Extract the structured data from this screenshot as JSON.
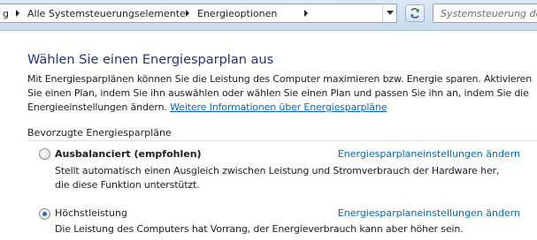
{
  "address_bar": {
    "fragment": "g",
    "crumbs": [
      "Alle Systemsteuerungselemente",
      "Energieoptionen"
    ],
    "dropdown_icon": "chevron-down-icon",
    "refresh_icon": "refresh-icon"
  },
  "search": {
    "placeholder": "Systemsteuerung durch"
  },
  "main": {
    "title": "Wählen Sie einen Energiesparplan aus",
    "intro_text": "Mit Energiesparplänen können Sie die Leistung des Computer maximieren bzw. Energie sparen. Aktivieren Sie einen Plan, indem Sie ihn auswählen oder wählen Sie einen Plan und passen Sie ihn an, indem Sie die Energieeinstellungen ändern.",
    "intro_link": "Weitere Informationen über Energiesparpläne",
    "group_label": "Bevorzugte Energiesparpläne",
    "plans": [
      {
        "name": "Ausbalanciert (empfohlen)",
        "description": "Stellt automatisch einen Ausgleich zwischen Leistung und Stromverbrauch der Hardware her, die diese Funktion unterstützt.",
        "link": "Energiesparplaneinstellungen ändern",
        "selected": false
      },
      {
        "name": "Höchstleistung",
        "description": "Die Leistung des Computers hat Vorrang, der Energieverbrauch kann aber höher sein.",
        "link": "Energiesparplaneinstellungen ändern",
        "selected": true
      }
    ]
  },
  "colors": {
    "heading": "#1e3287",
    "link": "#0066cc",
    "toolbar": "#dce8f4"
  }
}
